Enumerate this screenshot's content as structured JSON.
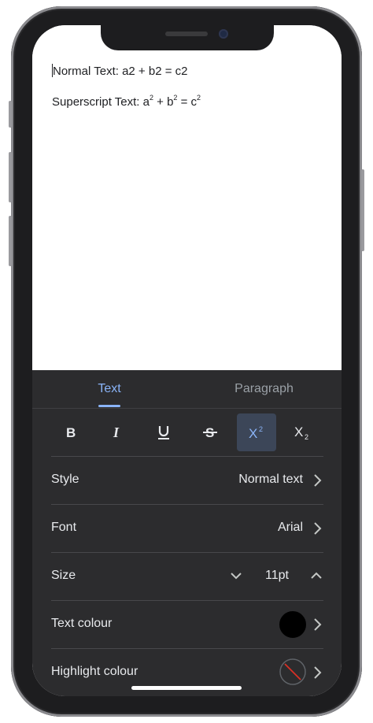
{
  "document": {
    "line1": {
      "prefix": "Normal Text: a2 + b2 = c2"
    },
    "line2": {
      "prefix": "Superscript Text: a",
      "sup_a": "2",
      "mid1": " + b",
      "sup_b": "2",
      "mid2": " = c",
      "sup_c": "2"
    }
  },
  "tabs": [
    {
      "label": "Text",
      "selected": true
    },
    {
      "label": "Paragraph",
      "selected": false
    }
  ],
  "format_buttons": [
    {
      "icon": "bold-icon",
      "glyph": "B"
    },
    {
      "icon": "italic-icon",
      "glyph": "I"
    },
    {
      "icon": "underline-icon",
      "glyph": "U"
    },
    {
      "icon": "strikethrough-icon",
      "glyph": "S"
    },
    {
      "icon": "superscript-icon",
      "glyph": "X",
      "sup": "2",
      "active": true
    },
    {
      "icon": "subscript-icon",
      "glyph": "X",
      "sub": "2"
    }
  ],
  "rows": {
    "style": {
      "label": "Style",
      "value": "Normal text"
    },
    "font": {
      "label": "Font",
      "value": "Arial"
    },
    "size": {
      "label": "Size",
      "value": "11pt"
    },
    "text_colour": {
      "label": "Text colour",
      "color": "#000000"
    },
    "highlight_colour": {
      "label": "Highlight colour",
      "color": "none"
    }
  },
  "colors": {
    "accent": "#8ab4f8",
    "panel": "#2c2c2e",
    "active_button_bg": "#3c4658",
    "no_highlight_slash": "#d93025"
  }
}
